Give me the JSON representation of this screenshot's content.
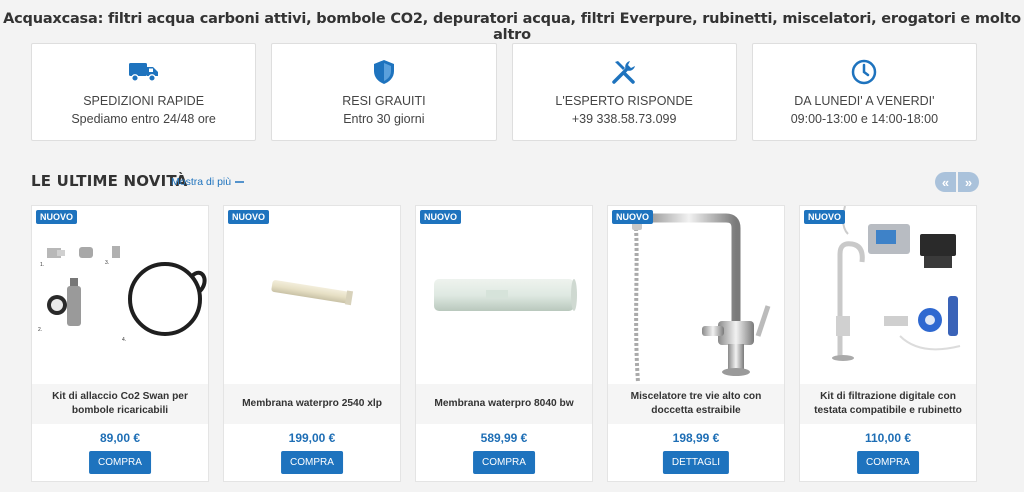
{
  "headline": "Acquaxcasa: filtri acqua carboni attivi, bombole CO2, depuratori acqua, filtri Everpure, rubinetti, miscelatori, erogatori e molto altro",
  "colors": {
    "accent": "#1e73be",
    "price": "#1e6eb5",
    "arrows": "#aac2db"
  },
  "features": [
    {
      "icon": "truck-icon",
      "title": "SPEDIZIONI RAPIDE",
      "subtitle": "Spediamo entro 24/48 ore"
    },
    {
      "icon": "shield-icon",
      "title": "RESI GRAUITI",
      "subtitle": "Entro 30 giorni"
    },
    {
      "icon": "tools-icon",
      "title": "L'ESPERTO RISPONDE",
      "subtitle": "+39 338.58.73.099"
    },
    {
      "icon": "clock-icon",
      "title": "DA LUNEDI' A VENERDI'",
      "subtitle": "09:00-13:00 e 14:00-18:00"
    }
  ],
  "section": {
    "title": "LE ULTIME NOVITÀ",
    "more_label": "Mostra di più"
  },
  "products": [
    {
      "badge": "NUOVO",
      "name": "Kit di allaccio Co2 Swan per bombole ricaricabili",
      "price": "89,00 €",
      "button": "COMPRA"
    },
    {
      "badge": "NUOVO",
      "name": "Membrana waterpro 2540 xlp",
      "price": "199,00 €",
      "button": "COMPRA"
    },
    {
      "badge": "NUOVO",
      "name": "Membrana waterpro 8040 bw",
      "price": "589,99 €",
      "button": "COMPRA"
    },
    {
      "badge": "NUOVO",
      "name": "Miscelatore tre vie alto con doccetta estraibile",
      "price": "198,99 €",
      "button": "DETTAGLI"
    },
    {
      "badge": "NUOVO",
      "name": "Kit di filtrazione digitale con testata compatibile e rubinetto",
      "price": "110,00 €",
      "button": "COMPRA"
    }
  ]
}
